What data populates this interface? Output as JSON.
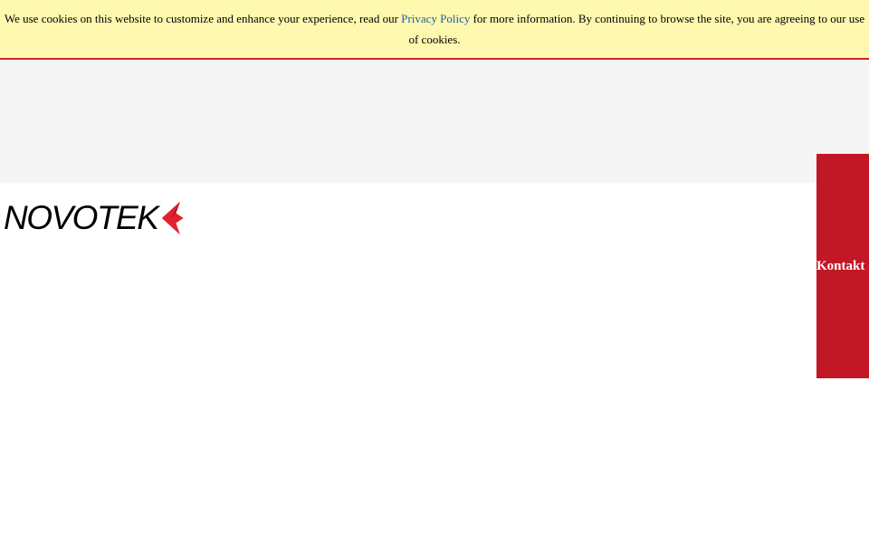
{
  "cookie_banner": {
    "text_before_link": "We use cookies on this website to customize and enhance your experience, read our ",
    "link_label": "Privacy Policy",
    "text_after_link": " for more information. By continuing to browse the site, you are agreeing to our use of cookies."
  },
  "header": {
    "logo_text": "NOVOTEK",
    "logo_icon": "novotek-arrow-mark"
  },
  "contact_tab": {
    "label": "Kontakt"
  },
  "colors": {
    "banner_background": "#fff9b0",
    "banner_border": "#d9222a",
    "link": "#1a5fa8",
    "grey_band": "#f5f5f5",
    "accent_red": "#c21724",
    "logo_mark_red": "#e3202e"
  }
}
